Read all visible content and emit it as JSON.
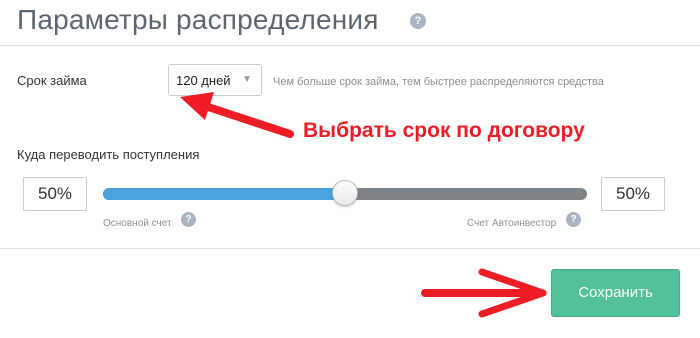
{
  "header": {
    "title": "Параметры распределения",
    "help_icon": "?"
  },
  "loan_term": {
    "label": "Срок займа",
    "selected": "120 дней",
    "hint": "Чем больше срок займа, тем быстрее распределяются средства"
  },
  "annotation": {
    "text": "Выбрать срок по договору",
    "color": "#ee1c25"
  },
  "distribution": {
    "label": "Куда переводить поступления",
    "left_percent": "50%",
    "right_percent": "50%",
    "slider_fraction": 0.5,
    "left_account_label": "Основной счет",
    "right_account_label": "Счет Автоинвестор",
    "help_icon": "?"
  },
  "actions": {
    "save_label": "Сохранить"
  },
  "colors": {
    "slider_fill": "#4aa3df",
    "slider_track": "#7f8489",
    "save_button": "#53c197",
    "arrow": "#ee1c25"
  }
}
